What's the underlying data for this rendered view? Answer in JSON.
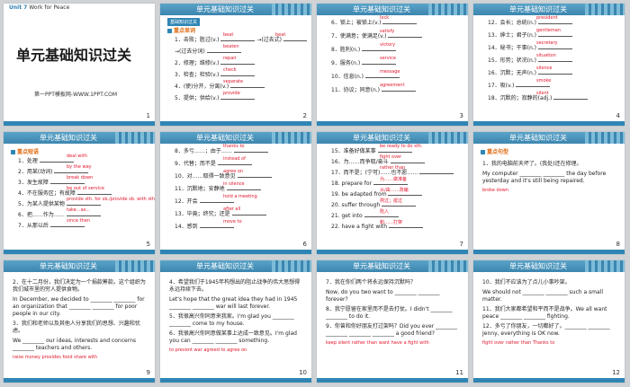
{
  "colors": {
    "header": "#3c86b0",
    "answer": "#e0162b",
    "section": "#e06a10"
  },
  "slides": [
    {
      "num": "1",
      "unit": "Unit 7",
      "unit_sub": "Work for Peace",
      "title": "单元基础知识过关",
      "site": "第一PPT模板网-WWW.1PPT.COM"
    },
    {
      "num": "2",
      "header": "单元基础知识过关",
      "tag": "基础知识过关",
      "section": "重点单词",
      "rows": [
        {
          "q": "1．击败；胜过(v.)",
          "a": "beat",
          "q2": "→(过去式)",
          "a2": "beat"
        },
        {
          "q": "→(过去分词)",
          "a": "beaten"
        },
        {
          "q": "2．修理；维修(v.)",
          "a": "repair"
        },
        {
          "q": "3．检查；检验(v.)",
          "a": "check"
        },
        {
          "q": "4．(使)分开，分离(v.)",
          "a": "separate"
        },
        {
          "q": "5．提供；供给(v.)",
          "a": "provide"
        }
      ]
    },
    {
      "num": "3",
      "header": "单元基础知识过关",
      "rows": [
        {
          "q": "6．锁上；被锁上(v.)",
          "a": "lock"
        },
        {
          "q": "7．使满意；使满足(v.)",
          "a": "satisfy"
        },
        {
          "q": "8．胜利(n.)",
          "a": "victory"
        },
        {
          "q": "9．服务(n.)",
          "a": "service"
        },
        {
          "q": "10．信息(n.)",
          "a": "message"
        },
        {
          "q": "11．协议；同意(n.)",
          "a": "agreement"
        }
      ]
    },
    {
      "num": "4",
      "header": "单元基础知识过关",
      "rows": [
        {
          "q": "12．会长；总统(n.)",
          "a": "president"
        },
        {
          "q": "13．绅士；君子(n.)",
          "a": "gentleman"
        },
        {
          "q": "14．秘书；干事(n.)",
          "a": "secretary"
        },
        {
          "q": "15．形势；状况(n.)",
          "a": "situation"
        },
        {
          "q": "16．沉默；无声(n.)",
          "a": "silence"
        },
        {
          "q": "17．吸(v.)",
          "a": "smoke"
        },
        {
          "q": "18．沉默的；寂静的(adj.)",
          "a": "silent"
        }
      ]
    },
    {
      "num": "5",
      "header": "单元基础知识过关",
      "section": "重点短语",
      "rows": [
        {
          "q": "1．处理",
          "a": "deal with"
        },
        {
          "q": "2．用某(动词)",
          "a": "by the way"
        },
        {
          "q": "3．发生故障",
          "a": "break down"
        },
        {
          "q": "4．不在服务区；有故障",
          "a": "be out of service"
        },
        {
          "q": "5．为某人提供某物",
          "a": "provide sth. for sb./provide sb. with sth."
        },
        {
          "q": "6．把……作为……",
          "a": "take...as..."
        },
        {
          "q": "7．从那以后",
          "a": "since then"
        }
      ]
    },
    {
      "num": "6",
      "header": "单元基础知识过关",
      "rows": [
        {
          "q": "8．多亏……；由于……",
          "a": "thanks to"
        },
        {
          "q": "9．代替；而不是",
          "a": "instead of"
        },
        {
          "q": "10．对……取得一致意见",
          "a": "agree on"
        },
        {
          "q": "11．沉默地；安静地",
          "a": "in silence"
        },
        {
          "q": "12．开会",
          "a": "hold a meeting"
        },
        {
          "q": "13．毕竟；终究；还是",
          "a": "after all"
        },
        {
          "q": "14．感到",
          "a": "move to"
        }
      ]
    },
    {
      "num": "7",
      "header": "单元基础知识过关",
      "rows": [
        {
          "q": "15．准备好做某事",
          "a": "be ready to do sth."
        },
        {
          "q": "16．为……而争取/奋斗",
          "a": "fight over"
        },
        {
          "q": "17．而不是；(宁可)……也不愿……",
          "a": "rather than"
        },
        {
          "q": "18. prepare for",
          "a": "为……做准备"
        },
        {
          "q": "19. be adapted from",
          "a": "从/由……改编"
        },
        {
          "q": "20. suffer through",
          "a": "熬过；挺过"
        },
        {
          "q": "21. get into",
          "a": "陷入"
        },
        {
          "q": "22. have a fight with",
          "a": "和……打架"
        }
      ]
    },
    {
      "num": "8",
      "header": "单元基础知识过关",
      "section": "重点句型",
      "sentence": "1．我的电脑前天坏了。(我处)还在修理。",
      "line2": "My computer ________ ________ the day before yesterday and it's still being repaired.",
      "answers": [
        "broke",
        "down"
      ]
    },
    {
      "num": "9",
      "header": "单元基础知识过关",
      "sentence": "2．在十二月份，我们决定为一个捐款筹款。这个组织为我们城市里的穷人提供食物。",
      "line2": "In December, we decided to ________ ________ for an organization that ________ ________ for poor people in our city.",
      "line3": "3．我们和老师以及其他人分享我们的思想、兴趣和忧虑。",
      "line4": "We ________ our ideas, interests and concerns ________ teachers and others.",
      "answers": [
        "raise",
        "money",
        "provides",
        "food",
        "share",
        "with"
      ]
    },
    {
      "num": "10",
      "header": "单元基础知识过关",
      "sentence": "4．希望我们于1945年构想出的阻止战争的伟大思想得永远持续下去。",
      "line2": "Let's hope that the great idea they had in 1945 ________ ________ war will last forever.",
      "line3": "5．我很高兴你同意来我家。I'm glad you ________ ________ come to my house.",
      "line4": "6．我很高兴你同意做某事上达成一致意见。I'm glad you can ________ ________ something.",
      "answers": [
        "to",
        "prevent",
        "war",
        "agreed",
        "to",
        "agree",
        "on"
      ]
    },
    {
      "num": "11",
      "header": "单元基础知识过关",
      "sentence": "7．我在你们两个将永远保持沉默吗？",
      "line2": "Now, do you two want to ________ ________ forever?",
      "line3": "8．我宁愿留在家里而不是去打仗。I didn't ________ ________ to do it.",
      "line4": "9．你曾和你好朋友打过架吗？Did you ever ________ ________ ________ ________ a good friend?",
      "answers": [
        "keep",
        "silent",
        "rather",
        "than",
        "want",
        "have",
        "a",
        "fight",
        "with"
      ]
    },
    {
      "num": "12",
      "header": "单元基础知识过关",
      "sentence": "10．我们不应该为了点儿小事吵架。",
      "line2": "We should not ________ ________ such a small matter.",
      "line3": "11．我们大家都希望和平而不是战争。We all want peace ________ ________ fighting.",
      "line4": "12．多亏了你朋友，一切都好了。________ ________ Jenny, everything is OK now.",
      "answers": [
        "fight",
        "over",
        "rather",
        "than",
        "Thanks",
        "to"
      ]
    }
  ]
}
